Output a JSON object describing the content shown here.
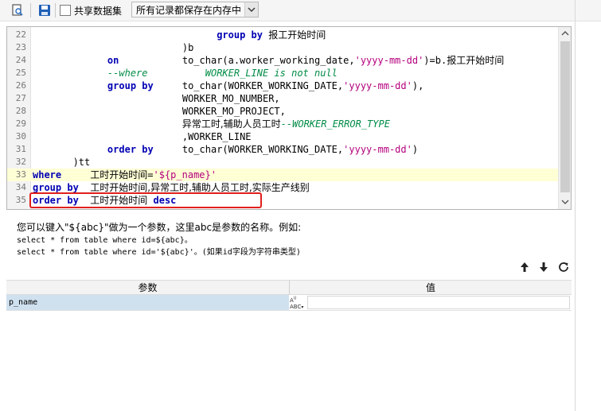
{
  "toolbar": {
    "share_dataset_label": "共享数据集",
    "storage_select_value": "所有记录都保存在内存中"
  },
  "editor": {
    "lines": [
      {
        "n": "22",
        "html": "                                <span class=\"kw\">group by</span> <span class=\"cn\">报工开始时间</span>"
      },
      {
        "n": "23",
        "html": "                          )b"
      },
      {
        "n": "24",
        "html": "             <span class=\"kw\">on</span>           to_char(a.worker_working_date,<span class=\"str\">'yyyy-mm-dd'</span>)=b.<span class=\"cn\">报工开始时间</span>"
      },
      {
        "n": "25",
        "html": "             <span class=\"cmt\">--where          WORKER_LINE is not null</span>"
      },
      {
        "n": "26",
        "html": "             <span class=\"kw\">group by</span>     to_char(WORKER_WORKING_DATE,<span class=\"str\">'yyyy-mm-dd'</span>),"
      },
      {
        "n": "27",
        "html": "                          WORKER_MO_NUMBER,"
      },
      {
        "n": "28",
        "html": "                          WORKER_MO_PROJECT,"
      },
      {
        "n": "29",
        "html": "                          <span class=\"cn\">异常工时,辅助人员工时</span><span class=\"cmt\">--WORKER_ERROR_TYPE</span>"
      },
      {
        "n": "30",
        "html": "                          ,WORKER_LINE"
      },
      {
        "n": "31",
        "html": "             <span class=\"kw\">order by</span>     to_char(WORKER_WORKING_DATE,<span class=\"str\">'yyyy-mm-dd'</span>)"
      },
      {
        "n": "32",
        "html": "       )tt"
      },
      {
        "n": "33",
        "html": "<span class=\"kw\">where</span>     <span class=\"cn\">工时开始时间</span>=<span class=\"str\">'${p_name}'</span>",
        "hl": true
      },
      {
        "n": "34",
        "html": "<span class=\"kw\">group by</span>  <span class=\"cn\">工时开始时间,异常工时,辅助人员工时,实际生产线别</span>"
      },
      {
        "n": "35",
        "html": "<span class=\"kw\">order by</span>  <span class=\"cn\">工时开始时间</span> <span class=\"kw\">desc</span>"
      }
    ]
  },
  "hint": {
    "line1": "您可以键入\"${abc}\"做为一个参数，这里abc是参数的名称。例如:",
    "line2": "select * from table where id=${abc}。",
    "line3": "select * from table where id='${abc}'。(如果id字段为字符串类型)"
  },
  "params": {
    "header_param": "参数",
    "header_value": "值",
    "rows": [
      {
        "name": "p_name",
        "type_label": "A U\nABC",
        "value": ""
      }
    ]
  },
  "icons": [
    "preview-icon",
    "save-icon",
    "move-up-icon",
    "move-down-icon",
    "refresh-icon",
    "dropdown-arrow-icon"
  ],
  "colors": {
    "keyword": "#0000b4",
    "string": "#b4007d",
    "comment": "#008c46",
    "highlight_line": "#ffffd6",
    "annotation_box": "#e0201c",
    "selected_row": "#cfe0ef"
  }
}
